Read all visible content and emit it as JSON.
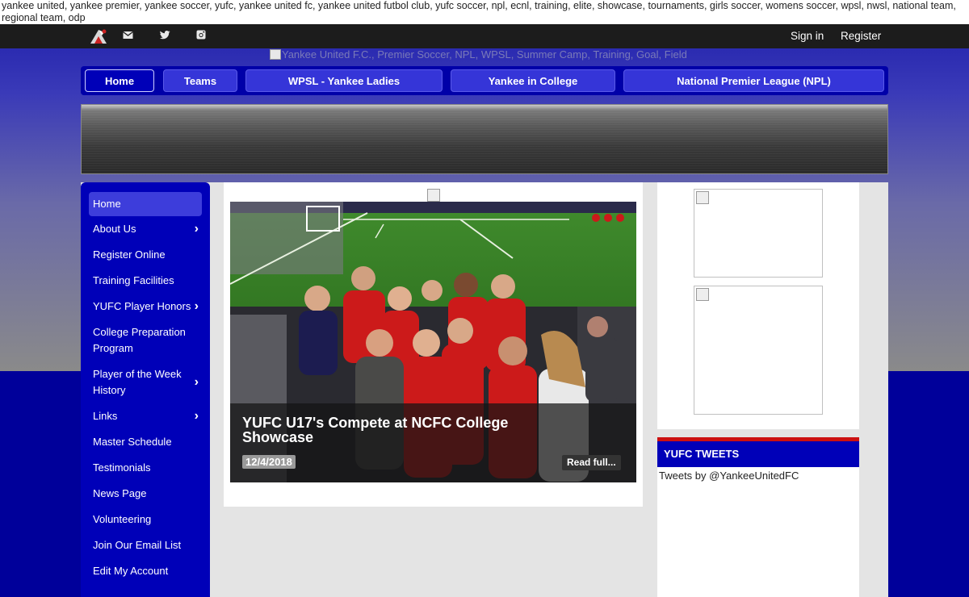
{
  "keywords": "yankee united, yankee premier, yankee soccer, yufc, yankee united fc, yankee united futbol club, yufc soccer, npl, ecnl, training, elite, showcase, tournaments, girls soccer, womens soccer, wpsl, nwsl, national team, regional team, odp",
  "topbar": {
    "icons": [
      "email-icon",
      "twitter-icon",
      "instagram-icon"
    ],
    "sign_in": "Sign in",
    "register": "Register"
  },
  "banner_alt": "Yankee United F.C., Premier Soccer, NPL, WPSL, Summer Camp, Training, Goal, Field",
  "nav": [
    {
      "label": "Home",
      "active": true
    },
    {
      "label": "Teams"
    },
    {
      "label": "WPSL - Yankee Ladies"
    },
    {
      "label": "Yankee in College"
    },
    {
      "label": "National Premier League (NPL)"
    }
  ],
  "sidebar": {
    "items": [
      {
        "label": "Home",
        "active": true
      },
      {
        "label": "About Us",
        "has_submenu": true
      },
      {
        "label": "Register Online"
      },
      {
        "label": "Training Facilities"
      },
      {
        "label": "YUFC Player Honors",
        "has_submenu": true
      },
      {
        "label": "College Preparation Program"
      },
      {
        "label": "Player of the Week History",
        "has_submenu": true
      },
      {
        "label": "Links",
        "has_submenu": true
      },
      {
        "label": "Master Schedule"
      },
      {
        "label": "Testimonials"
      },
      {
        "label": "News Page"
      },
      {
        "label": "Volunteering"
      },
      {
        "label": "Join Our Email List"
      },
      {
        "label": "Edit My Account"
      }
    ]
  },
  "news": {
    "title": "YUFC U17's Compete at NCFC College Showcase",
    "date": "12/4/2018",
    "read_more": "Read full...",
    "slide_count": 3
  },
  "tweets": {
    "heading": "YUFC TWEETS",
    "link_text": "Tweets by @YankeeUnitedFC"
  },
  "colors": {
    "brand_blue": "#0000b8",
    "nav_button": "#3535d8",
    "accent_red": "#cc1111"
  }
}
